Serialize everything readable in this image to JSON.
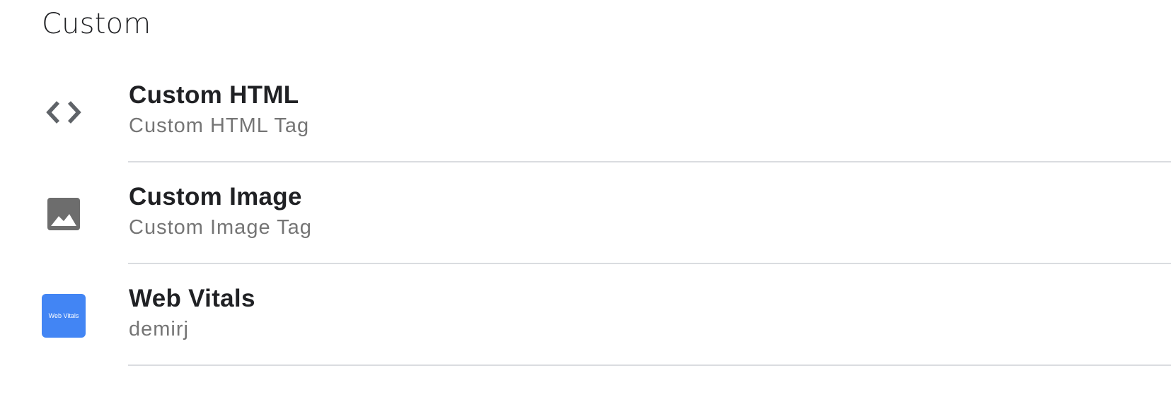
{
  "section": {
    "title": "Custom"
  },
  "tags": [
    {
      "name": "Custom HTML",
      "description": "Custom HTML Tag",
      "icon": "code-icon",
      "icon_color": "#5f6368"
    },
    {
      "name": "Custom Image",
      "description": "Custom Image Tag",
      "icon": "image-icon",
      "icon_color": "#6d6d6d"
    },
    {
      "name": "Web Vitals",
      "description": "demirj",
      "icon": "web-vitals-logo",
      "icon_color": "#4285f4",
      "logo_text": "Web Vitals"
    }
  ]
}
